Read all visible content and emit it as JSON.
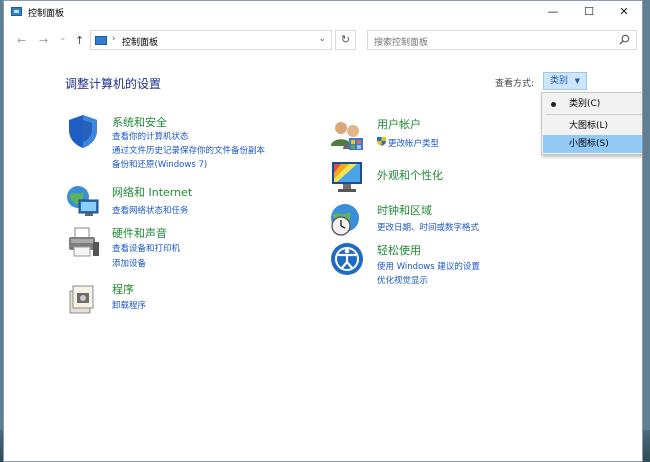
{
  "window": {
    "title": "控制面板",
    "minimize": "—",
    "maximize": "☐",
    "close": "✕"
  },
  "nav": {
    "back": "←",
    "forward": "→",
    "recent": "⌄",
    "up": "↑",
    "address": "控制面板",
    "address_sep": "›",
    "address_dropdown": "⌄",
    "refresh": "↻",
    "search_placeholder": "搜索控制面板"
  },
  "heading": "调整计算机的设置",
  "view_by": {
    "label": "查看方式:",
    "value": "类别",
    "arrow": "▼",
    "options": [
      "类别(C)",
      "大图标(L)",
      "小图标(S)"
    ],
    "checked_index": 0,
    "highlighted_index": 2
  },
  "left_categories": [
    {
      "title": "系统和安全",
      "links": [
        "查看你的计算机状态",
        "通过文件历史记录保存你的文件备份副本",
        "备份和还原(Windows 7)"
      ]
    },
    {
      "title": "网络和 Internet",
      "links": [
        "查看网络状态和任务"
      ]
    },
    {
      "title": "硬件和声音",
      "links": [
        "查看设备和打印机",
        "添加设备"
      ]
    },
    {
      "title": "程序",
      "links": [
        "卸载程序"
      ]
    }
  ],
  "right_categories": [
    {
      "title": "用户帐户",
      "links": [
        "更改帐户类型"
      ]
    },
    {
      "title": "外观和个性化",
      "links": []
    },
    {
      "title": "时钟和区域",
      "links": [
        "更改日期、时间或数字格式"
      ]
    },
    {
      "title": "轻松使用",
      "links": [
        "使用 Windows 建议的设置",
        "优化视觉显示"
      ]
    }
  ],
  "colors": {
    "heading": "#1e3287",
    "category_title": "#1f8a35",
    "link": "#1a56c9",
    "menu_highlight": "#91c9f7"
  }
}
